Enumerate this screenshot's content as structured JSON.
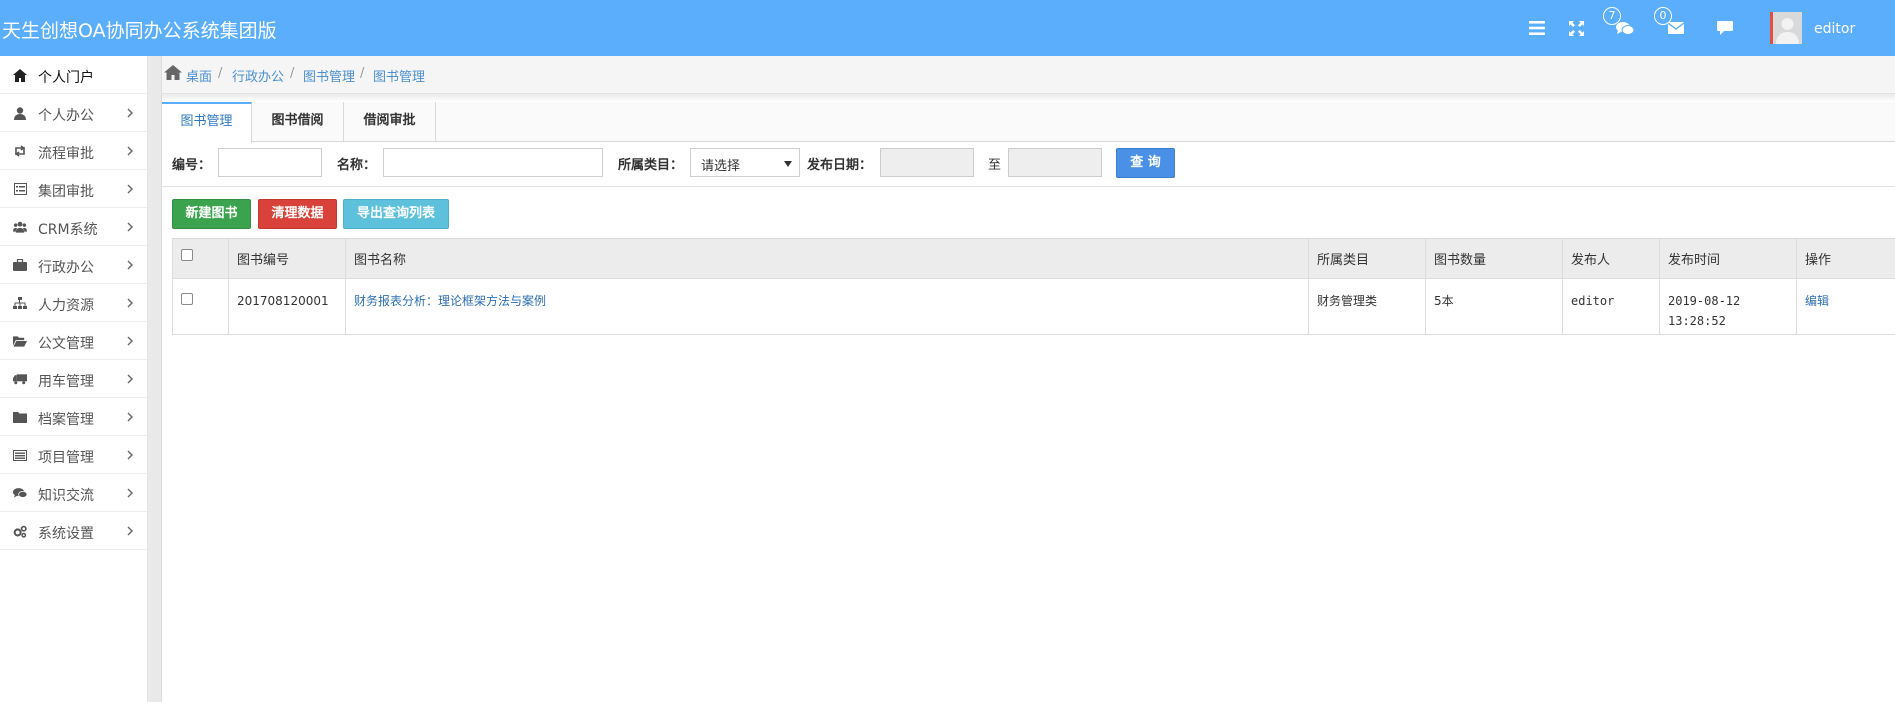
{
  "header": {
    "title": "天生创想OA协同办公系统集团版",
    "chat_badge": "7",
    "mail_badge": "0",
    "username": "editor",
    "icons": [
      "menu-icon",
      "fullscreen-icon",
      "chat-icon",
      "mail-icon",
      "comment-icon"
    ],
    "bg_color": "#5aaefc"
  },
  "sidebar": {
    "items": [
      {
        "label": "个人门户",
        "icon": "home-icon"
      },
      {
        "label": "个人办公",
        "icon": "user-icon"
      },
      {
        "label": "流程审批",
        "icon": "retweet-icon"
      },
      {
        "label": "集团审批",
        "icon": "list-alt-icon"
      },
      {
        "label": "CRM系统",
        "icon": "users-icon"
      },
      {
        "label": "行政办公",
        "icon": "briefcase-icon"
      },
      {
        "label": "人力资源",
        "icon": "sitemap-icon"
      },
      {
        "label": "公文管理",
        "icon": "folder-open-icon"
      },
      {
        "label": "用车管理",
        "icon": "truck-icon"
      },
      {
        "label": "档案管理",
        "icon": "folder-icon"
      },
      {
        "label": "项目管理",
        "icon": "list-icon"
      },
      {
        "label": "知识交流",
        "icon": "comments-icon"
      },
      {
        "label": "系统设置",
        "icon": "cogs-icon"
      }
    ]
  },
  "breadcrumb": [
    "桌面",
    "行政办公",
    "图书管理",
    "图书管理"
  ],
  "tabs": [
    "图书管理",
    "图书借阅",
    "借阅审批"
  ],
  "filters": {
    "code_label": "编号：",
    "name_label": "名称：",
    "category_label": "所属类目：",
    "category_value": "请选择",
    "date_label": "发布日期：",
    "to_label": "至",
    "query_button": "查 询"
  },
  "actions": {
    "new_book": "新建图书",
    "clear_data": "清理数据",
    "export_list": "导出查询列表"
  },
  "table": {
    "headers": [
      "图书编号",
      "图书名称",
      "所属类目",
      "图书数量",
      "发布人",
      "发布时间",
      "操作"
    ],
    "rows": [
      {
        "code": "201708120001",
        "name": "财务报表分析：理论框架方法与案例",
        "category": "财务管理类",
        "quantity": "5本",
        "publisher": "editor",
        "date": "2019-08-12",
        "time": "13:28:52",
        "action": "编辑"
      }
    ]
  }
}
